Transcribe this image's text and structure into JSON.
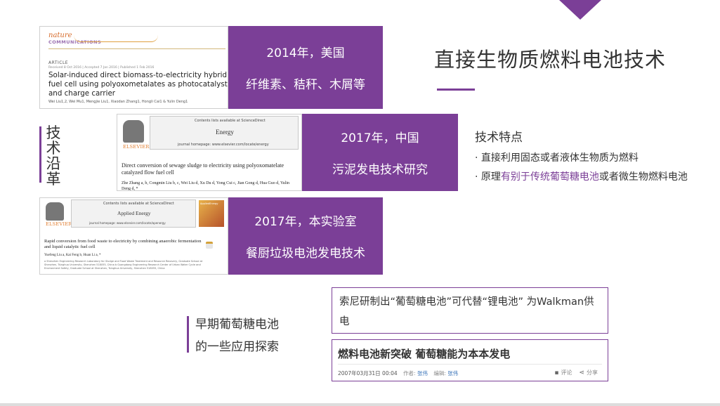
{
  "title": "直接生物质燃料电池技术",
  "side_label": [
    "技",
    "术",
    "沿",
    "革"
  ],
  "papers": [
    {
      "journal_logo_top": "nature",
      "journal_logo_bottom": "COMMUNICATIONS",
      "section": "ARTICLE",
      "dates": "Received 8 Oct 2016 | Accepted 7 Jan 2016 | Published 1 Feb 2016",
      "title": "Solar-induced direct biomass-to-electricity hybrid fuel cell using polyoxometalates as photocatalyst and charge carrier",
      "authors": "Wei Liu1,2, Wei Mu1, Mengjie Liu1, Xiaodan Zhang1, Hongli Cai1 & Yulin Deng1",
      "year_place": "2014年，美国",
      "subject": "纤维素、秸秆、木屑等"
    },
    {
      "publisher": "ELSEVIER",
      "contents_line": "Contents lists available at ScienceDirect",
      "journal": "Energy",
      "homepage": "journal homepage: www.elsevier.com/locate/energy",
      "title": "Direct conversion of sewage sludge to electricity using polyoxomatelate catalyzed flow fuel cell",
      "authors": "Zhe Zhang a, b, Congmin Liu b, c, Wei Liu d, Xu Du d, Yong Cui c, Jian Gong d, Hua Guo d, Yulin Deng d, *",
      "year_place": "2017年，中国",
      "subject": "污泥发电技术研究"
    },
    {
      "publisher": "ELSEVIER",
      "contents_line": "Contents lists available at ScienceDirect",
      "journal": "Applied Energy",
      "cover_label": "AppliedEnergy",
      "homepage": "journal homepage: www.elsevier.com/locate/apenergy",
      "title": "Rapid conversion from food waste to electricity by combining anaerobic fermentation and liquid catalytic fuel cell",
      "authors": "Yuefeng Liu a, Kai Feng b, Huan Li a, *",
      "affiliation": "a Shenzhen Engineering Research Laboratory for Sludge and Food Waste Treatment and Resource Recovery, Graduate School at Shenzhen, Tsinghua University, Shenzhen 518055, China b Guangdong Engineering Research Center of Urban Water Cycle and Environment Safety, Graduate School at Shenzhen, Tsinghua University, Shenzhen 518055, China",
      "year_place": "2017年，本实验室",
      "subject": "餐厨垃圾电池发电技术"
    }
  ],
  "features": {
    "heading": "技术特点",
    "item1": "· 直接利用固态或者液体生物质为燃料",
    "item2_prefix": "· 原理",
    "item2_highlight": "有别于传统葡萄糖电池",
    "item2_suffix": "或者微生物燃料电池"
  },
  "early": {
    "line1": "早期葡萄糖电池",
    "line2": "的一些应用探索"
  },
  "sony_text": "索尼研制出“葡萄糖电池”可代替“锂电池” 为Walkman供电",
  "news": {
    "title": "燃料电池新突破 葡萄糖能为本本发电",
    "date": "2007年03月31日 00:04",
    "author_label": "作者:",
    "author": "张伟",
    "editor_label": "编辑:",
    "editor": "张伟",
    "comment": "评论",
    "share": "分享"
  },
  "colors": {
    "accent": "#7b3f97"
  }
}
